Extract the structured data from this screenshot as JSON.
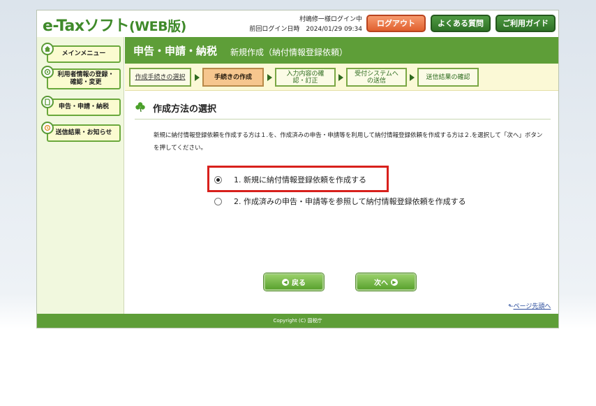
{
  "header": {
    "logo_main": "e-Taxソフト",
    "logo_web": "(WEB版)",
    "user_login": "村嶋修一様ログイン中",
    "last_login": "前回ログイン日時　2024/01/29 09:34",
    "logout_label": "ログアウト",
    "faq_label": "よくある質問",
    "guide_label": "ご利用ガイド"
  },
  "sidebar": {
    "items": [
      {
        "label": "メインメニュー",
        "icon": "home-icon"
      },
      {
        "label": "利用者情報の登録・確認・変更",
        "icon": "user-info-icon"
      },
      {
        "label": "申告・申請・納税",
        "icon": "document-icon"
      },
      {
        "label": "送信結果・お知らせ",
        "icon": "notice-icon"
      }
    ]
  },
  "titlebar": {
    "main": "申告・申請・納税",
    "sub": "新規作成（納付情報登録依頼）"
  },
  "steps": [
    {
      "label": "作成手続きの選択",
      "state": "done"
    },
    {
      "label": "手続きの作成",
      "state": "current"
    },
    {
      "label": "入力内容の確認・訂正",
      "state": "todo"
    },
    {
      "label": "受付システムへの送信",
      "state": "todo"
    },
    {
      "label": "送信結果の確認",
      "state": "todo"
    }
  ],
  "content": {
    "section_title": "作成方法の選択",
    "description": "新規に納付情報登録依頼を作成する方は１.を、作成済みの申告・申請等を利用して納付情報登録依頼を作成する方は２.を選択して「次へ」ボタンを押してください。",
    "options": [
      {
        "label": "1. 新規に納付情報登録依頼を作成する",
        "selected": true
      },
      {
        "label": "2. 作成済みの申告・申請等を参照して納付情報登録依頼を作成する",
        "selected": false
      }
    ],
    "back_label": "戻る",
    "next_label": "次へ",
    "page_top_label": "ページ先頭へ"
  },
  "footer": {
    "copyright": "Copyright (C) 国税庁"
  },
  "colors": {
    "brand_green": "#5e9e38",
    "logout_orange": "#e0602e",
    "highlight_red": "#d8201c"
  }
}
